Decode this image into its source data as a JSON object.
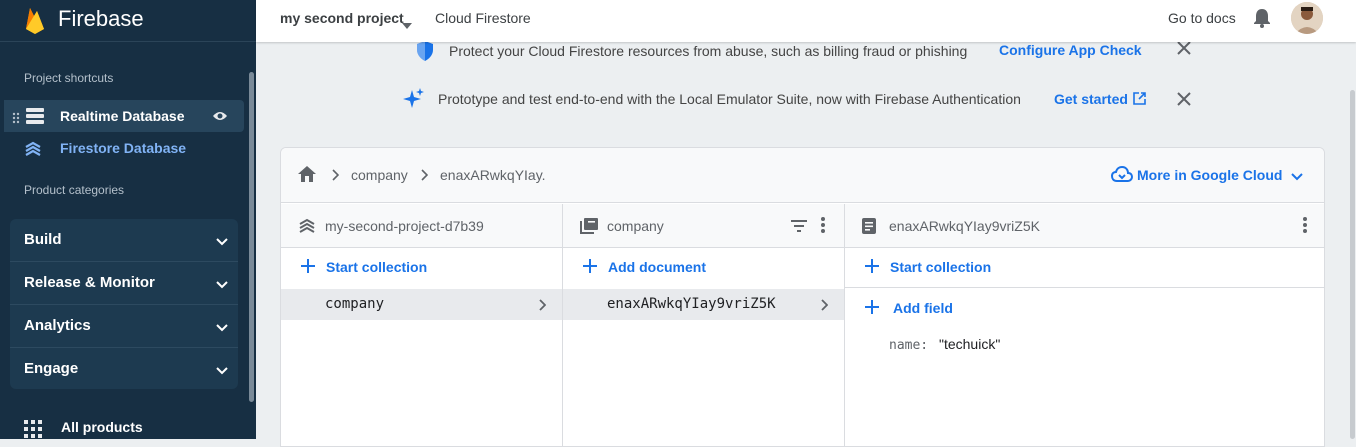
{
  "app": {
    "brand": "Firebase",
    "project": "my second project",
    "page_title": "Cloud Firestore"
  },
  "topbar": {
    "docs_label": "Go to docs"
  },
  "sidebar": {
    "shortcuts_heading": "Project shortcuts",
    "shortcuts": [
      {
        "label": "Realtime Database"
      },
      {
        "label": "Firestore Database"
      }
    ],
    "categories_heading": "Product categories",
    "categories": [
      {
        "label": "Build"
      },
      {
        "label": "Release & Monitor"
      },
      {
        "label": "Analytics"
      },
      {
        "label": "Engage"
      }
    ],
    "all_products": "All products"
  },
  "banners": [
    {
      "text": "Protect your Cloud Firestore resources from abuse, such as billing fraud or phishing",
      "link": "Configure App Check"
    },
    {
      "text": "Prototype and test end-to-end with the Local Emulator Suite, now with Firebase Authentication",
      "link": "Get started"
    }
  ],
  "breadcrumb": {
    "items": [
      "company",
      "enaxARwkqYIay."
    ],
    "cloud_link": "More in Google Cloud"
  },
  "columns": [
    {
      "title": "my-second-project-d7b39",
      "action": "Start collection",
      "rows": [
        "company"
      ]
    },
    {
      "title": "company",
      "action": "Add document",
      "rows": [
        "enaxARwkqYIay9vriZ5K"
      ]
    },
    {
      "title": "enaxARwkqYIay9vriZ5K",
      "action": "Start collection",
      "add_field": "Add field",
      "fields": [
        {
          "key": "name:",
          "value": "\"techuick\""
        }
      ]
    }
  ],
  "colors": {
    "sidebar_bg": "#172f43",
    "accent_blue": "#1a73e8",
    "firestore_active": "#81b3f5"
  }
}
